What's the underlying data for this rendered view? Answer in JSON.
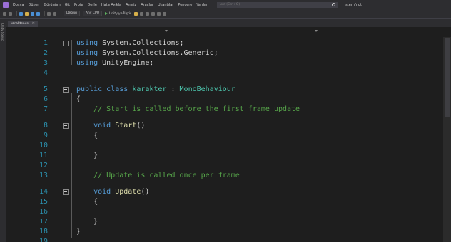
{
  "menubar": {
    "items": [
      "Dosya",
      "Düzen",
      "Görünüm",
      "Git",
      "Proje",
      "Derle",
      "Hata Ayıkla",
      "Analiz",
      "Araçlar",
      "Uzantılar",
      "Pencere",
      "Yardım"
    ],
    "search_placeholder": "Ara (Ctrl+Q)",
    "solution_name": "sternfnot"
  },
  "toolbar": {
    "configuration": "Debug",
    "platform": "Any CPU",
    "attach_label": "Unity'ye İliştir"
  },
  "side_panel": {
    "label": "Unity Sonuç"
  },
  "tab": {
    "label": "karakter.cs",
    "close": "×"
  },
  "editor": {
    "lines": [
      {
        "n": "1",
        "tokens": [
          [
            "kw",
            "using"
          ],
          [
            "txt",
            " System.Collections;"
          ]
        ]
      },
      {
        "n": "2",
        "tokens": [
          [
            "kw",
            "using"
          ],
          [
            "txt",
            " System.Collections.Generic;"
          ]
        ]
      },
      {
        "n": "3",
        "tokens": [
          [
            "kw",
            "using"
          ],
          [
            "txt",
            " UnityEngine;"
          ]
        ]
      },
      {
        "n": "4",
        "tokens": []
      },
      {
        "n": "5",
        "tokens": [
          [
            "kw",
            "public"
          ],
          [
            "txt",
            " "
          ],
          [
            "kw",
            "class"
          ],
          [
            "txt",
            " "
          ],
          [
            "cls",
            "karakter"
          ],
          [
            "txt",
            " : "
          ],
          [
            "cls",
            "MonoBehaviour"
          ]
        ]
      },
      {
        "n": "6",
        "tokens": [
          [
            "txt",
            "{"
          ]
        ]
      },
      {
        "n": "7",
        "tokens": [
          [
            "txt",
            "    "
          ],
          [
            "cmt",
            "// Start is called before the first frame update"
          ]
        ]
      },
      {
        "n": "8",
        "tokens": [
          [
            "txt",
            "    "
          ],
          [
            "kw",
            "void"
          ],
          [
            "txt",
            " "
          ],
          [
            "id",
            "Start"
          ],
          [
            "txt",
            "()"
          ]
        ]
      },
      {
        "n": "9",
        "tokens": [
          [
            "txt",
            "    {"
          ]
        ]
      },
      {
        "n": "10",
        "tokens": []
      },
      {
        "n": "11",
        "tokens": [
          [
            "txt",
            "    }"
          ]
        ]
      },
      {
        "n": "12",
        "tokens": []
      },
      {
        "n": "13",
        "tokens": [
          [
            "txt",
            "    "
          ],
          [
            "cmt",
            "// Update is called once per frame"
          ]
        ]
      },
      {
        "n": "14",
        "tokens": [
          [
            "txt",
            "    "
          ],
          [
            "kw",
            "void"
          ],
          [
            "txt",
            " "
          ],
          [
            "id",
            "Update"
          ],
          [
            "txt",
            "()"
          ]
        ]
      },
      {
        "n": "15",
        "tokens": [
          [
            "txt",
            "    {"
          ]
        ]
      },
      {
        "n": "16",
        "tokens": []
      },
      {
        "n": "17",
        "tokens": [
          [
            "txt",
            "    }"
          ]
        ]
      },
      {
        "n": "18",
        "tokens": [
          [
            "txt",
            "}"
          ]
        ]
      },
      {
        "n": "19",
        "tokens": []
      }
    ]
  }
}
